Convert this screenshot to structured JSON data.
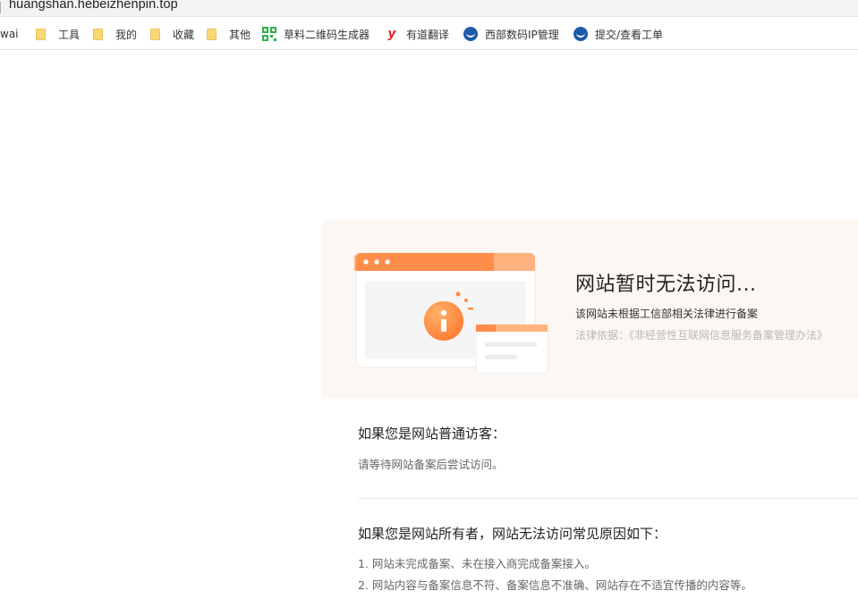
{
  "browser": {
    "url": "huangshan.hebeizhenpin.top",
    "bookmarks": [
      {
        "label": "wai",
        "icon": "none"
      },
      {
        "label": "工具",
        "icon": "folder-icon"
      },
      {
        "label": "我的",
        "icon": "folder-icon"
      },
      {
        "label": "收藏",
        "icon": "folder-icon"
      },
      {
        "label": "其他",
        "icon": "folder-icon"
      },
      {
        "label": "草料二维码生成器",
        "icon": "qrcode-icon"
      },
      {
        "label": "有道翻译",
        "icon": "youdao-icon"
      },
      {
        "label": "西部数码IP管理",
        "icon": "west-digital-icon"
      },
      {
        "label": "提交/查看工单",
        "icon": "west-digital-icon"
      }
    ]
  },
  "banner": {
    "title": "网站暂时无法访问...",
    "subtitle": "该网站未根据工信部相关法律进行备案",
    "law": "法律依据：《非经营性互联网信息服务备案管理办法》"
  },
  "visitor": {
    "heading": "如果您是网站普通访客：",
    "text": "请等待网站备案后尝试访问。"
  },
  "owner": {
    "heading": "如果您是网站所有者，网站无法访问常见原因如下：",
    "reasons": [
      "1. 网站未完成备案、未在接入商完成备案接入。",
      "2. 网站内容与备案信息不符、备案信息不准确、网站存在不适宜传播的内容等。"
    ]
  },
  "colors": {
    "accent": "#ff8a3d",
    "banner_bg": "#fdf7f3"
  }
}
